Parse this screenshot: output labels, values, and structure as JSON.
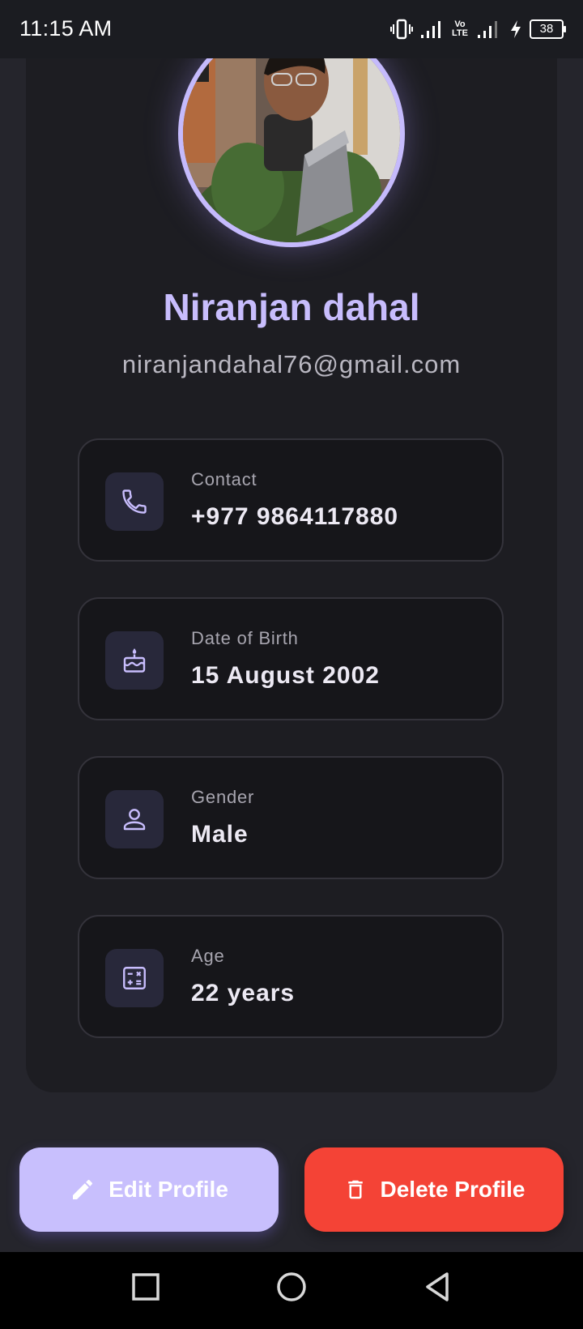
{
  "status_bar": {
    "time": "11:15 AM",
    "network_label": "Vo LTE",
    "battery": "38"
  },
  "profile": {
    "name": "Niranjan dahal",
    "email": "niranjandahal76@gmail.com"
  },
  "info_cards": [
    {
      "label": "Contact",
      "value": "+977 9864117880",
      "icon": "phone-icon"
    },
    {
      "label": "Date of Birth",
      "value": "15 August 2002",
      "icon": "cake-icon"
    },
    {
      "label": "Gender",
      "value": "Male",
      "icon": "person-icon"
    },
    {
      "label": "Age",
      "value": "22 years",
      "icon": "calculator-icon"
    }
  ],
  "actions": {
    "edit_label": "Edit Profile",
    "delete_label": "Delete Profile"
  },
  "colors": {
    "accent": "#c8bdfd",
    "danger": "#f44336",
    "background": "#25252c",
    "card": "#1d1d22"
  }
}
